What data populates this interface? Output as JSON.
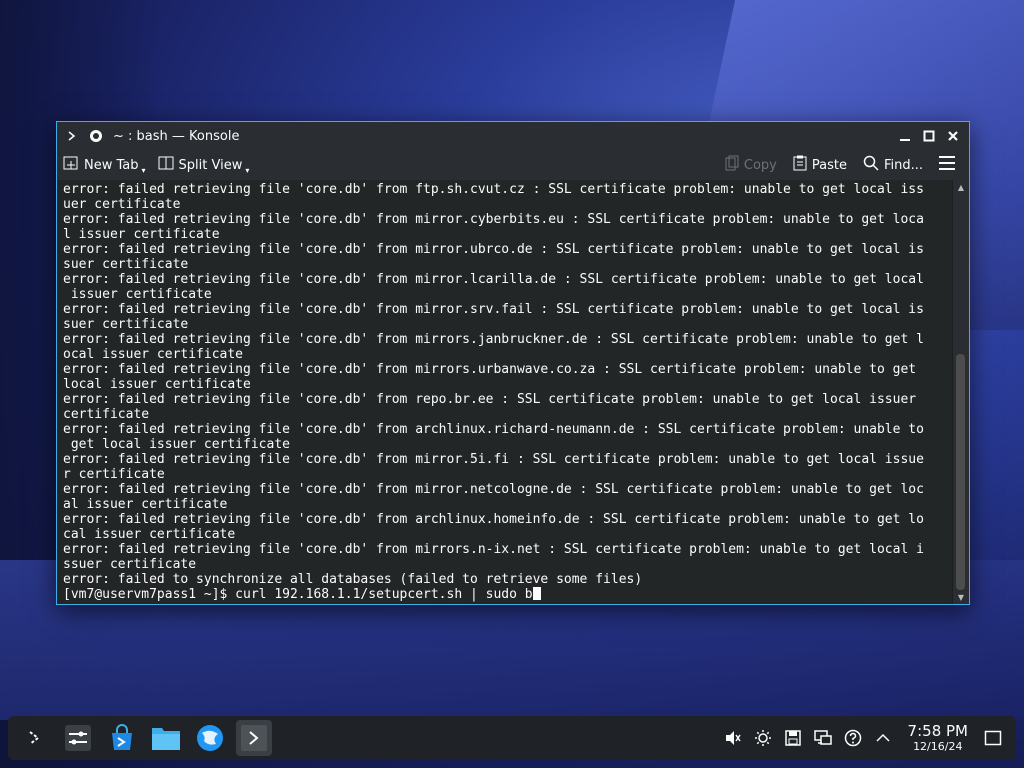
{
  "window": {
    "title": "~ : bash — Konsole"
  },
  "toolbar": {
    "new_tab": "New Tab",
    "split_view": "Split View",
    "copy": "Copy",
    "paste": "Paste",
    "find": "Find..."
  },
  "terminal": {
    "lines": [
      "error: failed retrieving file 'core.db' from ftp.sh.cvut.cz : SSL certificate problem: unable to get local iss",
      "uer certificate",
      "error: failed retrieving file 'core.db' from mirror.cyberbits.eu : SSL certificate problem: unable to get loca",
      "l issuer certificate",
      "error: failed retrieving file 'core.db' from mirror.ubrco.de : SSL certificate problem: unable to get local is",
      "suer certificate",
      "error: failed retrieving file 'core.db' from mirror.lcarilla.de : SSL certificate problem: unable to get local",
      " issuer certificate",
      "error: failed retrieving file 'core.db' from mirror.srv.fail : SSL certificate problem: unable to get local is",
      "suer certificate",
      "error: failed retrieving file 'core.db' from mirrors.janbruckner.de : SSL certificate problem: unable to get l",
      "ocal issuer certificate",
      "error: failed retrieving file 'core.db' from mirrors.urbanwave.co.za : SSL certificate problem: unable to get",
      "local issuer certificate",
      "error: failed retrieving file 'core.db' from repo.br.ee : SSL certificate problem: unable to get local issuer",
      "certificate",
      "error: failed retrieving file 'core.db' from archlinux.richard-neumann.de : SSL certificate problem: unable to",
      " get local issuer certificate",
      "error: failed retrieving file 'core.db' from mirror.5i.fi : SSL certificate problem: unable to get local issue",
      "r certificate",
      "error: failed retrieving file 'core.db' from mirror.netcologne.de : SSL certificate problem: unable to get loc",
      "al issuer certificate",
      "error: failed retrieving file 'core.db' from archlinux.homeinfo.de : SSL certificate problem: unable to get lo",
      "cal issuer certificate",
      "error: failed retrieving file 'core.db' from mirrors.n-ix.net : SSL certificate problem: unable to get local i",
      "ssuer certificate",
      "error: failed to synchronize all databases (failed to retrieve some files)"
    ],
    "prompt": "[vm7@uservm7pass1 ~]$ curl 192.168.1.1/setupcert.sh | sudo b"
  },
  "clock": {
    "time": "7:58 PM",
    "date": "12/16/24"
  }
}
